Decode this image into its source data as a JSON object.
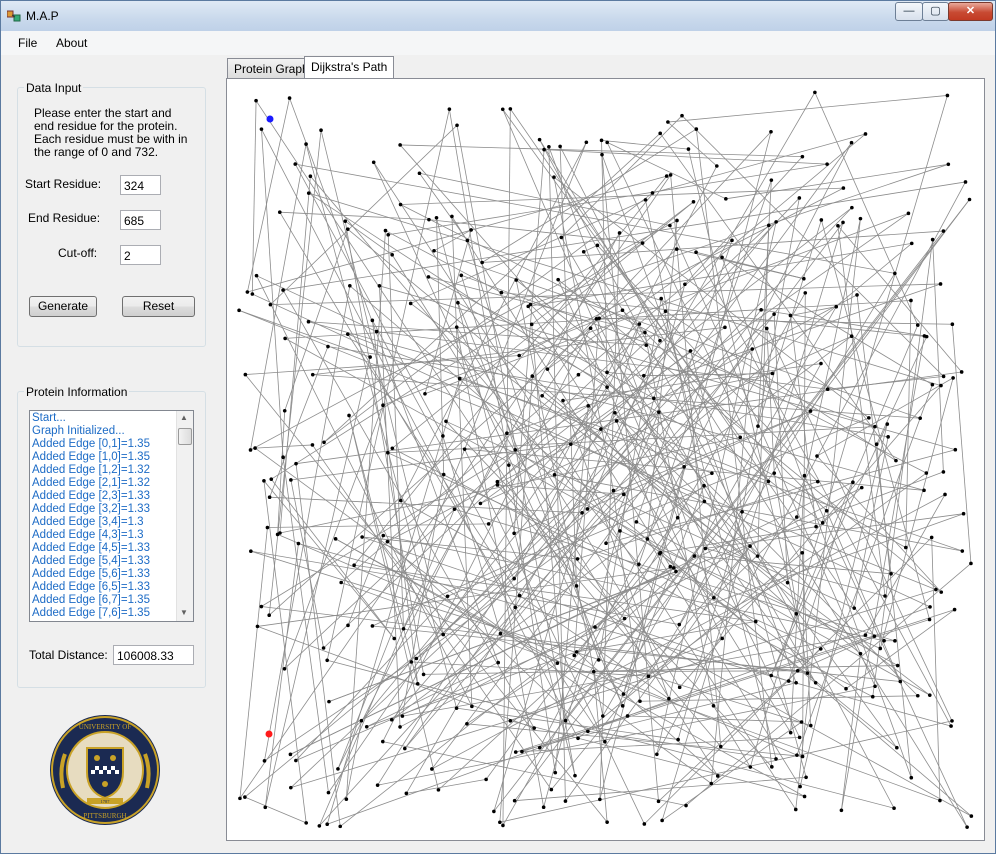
{
  "window": {
    "title": "M.A.P",
    "controls": {
      "minimize": "—",
      "maximize": "▢",
      "close": "✕"
    }
  },
  "menu": [
    "File",
    "About"
  ],
  "data_input": {
    "title": "Data Input",
    "instructions": "Please enter the start and end residue for the protein. Each residue must be with in the range of 0 and 732.",
    "start_label": "Start Residue:",
    "start_value": "324",
    "end_label": "End Residue:",
    "end_value": "685",
    "cutoff_label": "Cut-off:",
    "cutoff_value": "2",
    "generate_label": "Generate",
    "reset_label": "Reset"
  },
  "protein_info": {
    "title": "Protein Information",
    "log": [
      "Start...",
      "Graph Initialized...",
      "Added Edge [0,1]=1.35",
      "Added Edge [1,0]=1.35",
      "Added Edge [1,2]=1.32",
      "Added Edge [2,1]=1.32",
      "Added Edge [2,3]=1.33",
      "Added Edge [3,2]=1.33",
      "Added Edge [3,4]=1.3",
      "Added Edge [4,3]=1.3",
      "Added Edge [4,5]=1.33",
      "Added Edge [5,4]=1.33",
      "Added Edge [5,6]=1.33",
      "Added Edge [6,5]=1.33",
      "Added Edge [6,7]=1.35",
      "Added Edge [7,6]=1.35"
    ],
    "total_label": "Total Distance:",
    "total_value": "106008.33"
  },
  "tabs": [
    {
      "label": "Protein Graph",
      "active": false
    },
    {
      "label": "Dijkstra's Path",
      "active": true
    }
  ],
  "graph": {
    "node_color": "#000000",
    "edge_color": "#8c8c8c",
    "start_color": "#1a1aff",
    "end_color": "#ff1a1a",
    "node_count": 733
  },
  "logo": {
    "name": "university-seal",
    "lettering": [
      "UNIVERSITY OF",
      "PITTSBURGH",
      "1787"
    ],
    "colors": {
      "navy": "#1b2a52",
      "gold": "#c9a227"
    }
  }
}
